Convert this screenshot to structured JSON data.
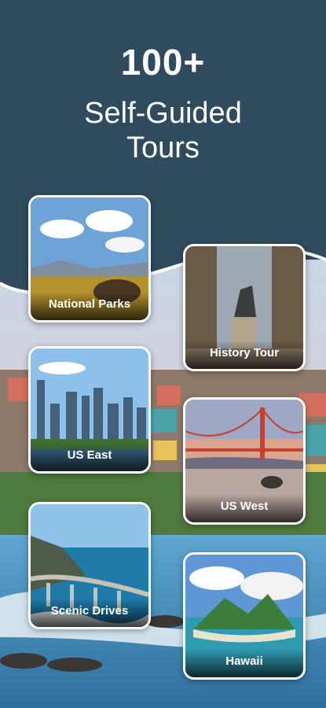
{
  "header": {
    "count": "100+",
    "line1": "Self-Guided",
    "line2": "Tours"
  },
  "cards": [
    {
      "label": "National Parks",
      "icon": "bison-photo"
    },
    {
      "label": "History Tour",
      "icon": "statue-photo"
    },
    {
      "label": "US East",
      "icon": "city-skyline-photo"
    },
    {
      "label": "US West",
      "icon": "golden-gate-photo"
    },
    {
      "label": "Scenic Drives",
      "icon": "coastal-bridge-photo"
    },
    {
      "label": "Hawaii",
      "icon": "island-photo"
    }
  ],
  "colors": {
    "header_bg": "#2f4b5d",
    "ocean": "#3b8fc0"
  }
}
